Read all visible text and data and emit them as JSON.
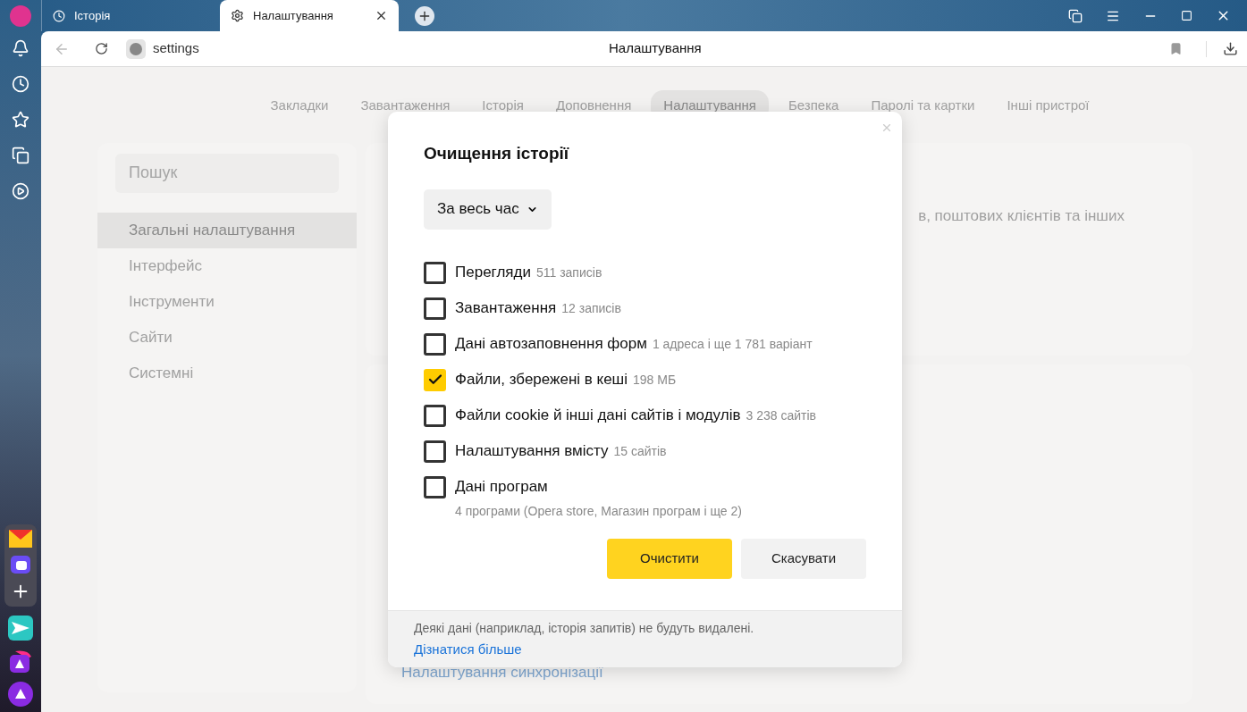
{
  "tabs": [
    {
      "label": "Історія",
      "selected": false
    },
    {
      "label": "Налаштування",
      "selected": true
    }
  ],
  "address_bar": {
    "url": "settings",
    "page_title": "Налаштування"
  },
  "nav": [
    {
      "label": "Закладки",
      "selected": false
    },
    {
      "label": "Завантаження",
      "selected": false
    },
    {
      "label": "Історія",
      "selected": false
    },
    {
      "label": "Доповнення",
      "selected": false
    },
    {
      "label": "Налаштування",
      "selected": true
    },
    {
      "label": "Безпека",
      "selected": false
    },
    {
      "label": "Паролі та картки",
      "selected": false
    },
    {
      "label": "Інші пристрої",
      "selected": false
    }
  ],
  "settings_sidebar": {
    "search": {
      "placeholder": "Пошук"
    },
    "items": [
      {
        "label": "Загальні налаштування",
        "selected": true
      },
      {
        "label": "Інтерфейс",
        "selected": false
      },
      {
        "label": "Інструменти",
        "selected": false
      },
      {
        "label": "Сайти",
        "selected": false
      },
      {
        "label": "Системні",
        "selected": false
      }
    ]
  },
  "background": {
    "text_fragment": "в, поштових клієнтів та інших",
    "sync_link": "Налаштування синхронізації"
  },
  "dialog": {
    "title": "Очищення історії",
    "period": "За весь час",
    "items": [
      {
        "label": "Перегляди",
        "detail": "511 записів",
        "checked": false,
        "kind": "inline"
      },
      {
        "label": "Завантаження",
        "detail": "12 записів",
        "checked": false,
        "kind": "inline"
      },
      {
        "label": "Дані автозаповнення форм",
        "detail": "1 адреса і ще 1 781 варіант",
        "checked": false,
        "kind": "inline"
      },
      {
        "label": "Файли, збережені в кеші",
        "detail": "198 МБ",
        "checked": true,
        "kind": "inline"
      },
      {
        "label": "Файли cookie й інші дані сайтів і модулів",
        "detail": "3 238 сайтів",
        "checked": false,
        "kind": "inline"
      },
      {
        "label": "Налаштування вмісту",
        "detail": "15 сайтів",
        "checked": false,
        "kind": "inline"
      },
      {
        "label": "Дані програм",
        "detail": "4 програми (Opera store, Магазин програм і ще 2)",
        "checked": false,
        "kind": "below"
      }
    ],
    "buttons": [
      {
        "label": "Очистити",
        "kind": "primary"
      },
      {
        "label": "Скасувати",
        "kind": "secondary"
      }
    ],
    "footer": {
      "note": "Деякі дані (наприклад, історія запитів) не будуть видалені.",
      "link": "Дізнатися більше"
    }
  }
}
